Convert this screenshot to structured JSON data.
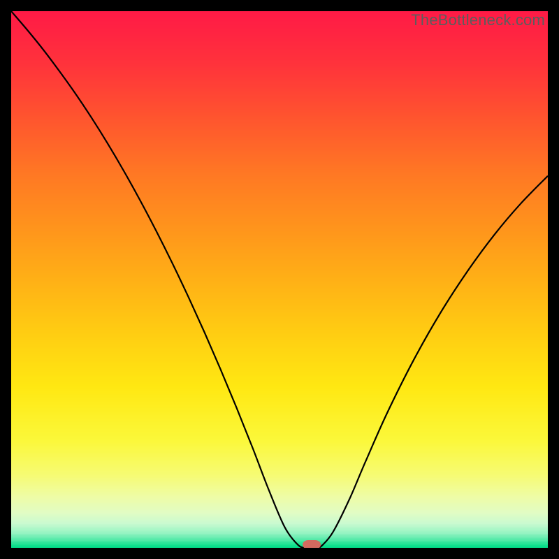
{
  "watermark": "TheBottleneck.com",
  "chart_data": {
    "type": "line",
    "title": "",
    "xlabel": "",
    "ylabel": "",
    "xlim": [
      0,
      100
    ],
    "ylim": [
      0,
      100
    ],
    "x": [
      0,
      3,
      6,
      9,
      12,
      15,
      18,
      21,
      24,
      27,
      30,
      33,
      36,
      39,
      42,
      45,
      48,
      51,
      53.5,
      55,
      56,
      57,
      58,
      60,
      63,
      66,
      70,
      75,
      80,
      85,
      90,
      95,
      100
    ],
    "y": [
      100,
      96.5,
      92.8,
      88.8,
      84.6,
      80.1,
      75.3,
      70.2,
      64.8,
      59.1,
      53.1,
      46.8,
      40.2,
      33.3,
      26.1,
      18.6,
      10.8,
      3.8,
      0.5,
      0.0,
      0.0,
      0.0,
      0.5,
      3.0,
      9.0,
      16.0,
      25.0,
      35.0,
      43.8,
      51.5,
      58.3,
      64.2,
      69.3
    ],
    "marker": {
      "x": 56,
      "y": 0
    },
    "gradient_stops": [
      {
        "pos": 0.0,
        "color": "#ff1a46"
      },
      {
        "pos": 0.1,
        "color": "#ff333b"
      },
      {
        "pos": 0.2,
        "color": "#ff552e"
      },
      {
        "pos": 0.3,
        "color": "#ff7724"
      },
      {
        "pos": 0.4,
        "color": "#ff931c"
      },
      {
        "pos": 0.5,
        "color": "#ffb016"
      },
      {
        "pos": 0.6,
        "color": "#ffcd12"
      },
      {
        "pos": 0.7,
        "color": "#ffe812"
      },
      {
        "pos": 0.8,
        "color": "#fbf83a"
      },
      {
        "pos": 0.865,
        "color": "#f6fb74"
      },
      {
        "pos": 0.905,
        "color": "#eefca6"
      },
      {
        "pos": 0.935,
        "color": "#e1fcc4"
      },
      {
        "pos": 0.955,
        "color": "#c9fad0"
      },
      {
        "pos": 0.972,
        "color": "#97f4c3"
      },
      {
        "pos": 0.985,
        "color": "#54eaa9"
      },
      {
        "pos": 0.995,
        "color": "#13e08e"
      },
      {
        "pos": 1.0,
        "color": "#00dd88"
      }
    ],
    "marker_style": {
      "fill": "#d46a5f",
      "rx": 8,
      "width": 26,
      "height": 13
    }
  }
}
